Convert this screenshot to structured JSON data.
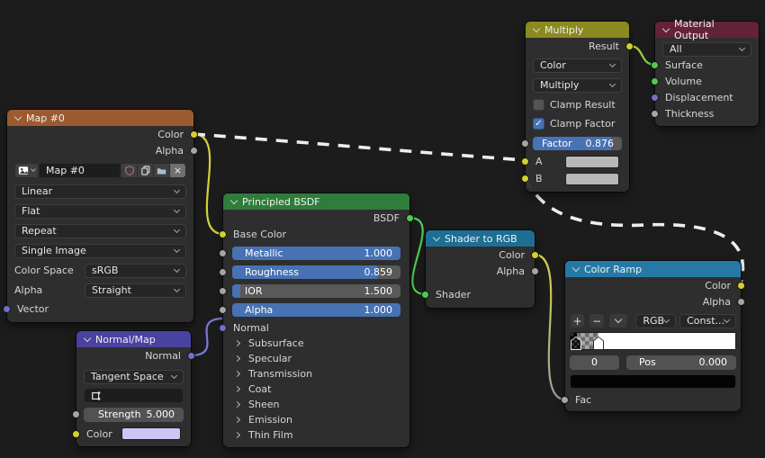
{
  "colors": {
    "background": "#1c1c1c",
    "accent_blue": "#4772b3",
    "header_texture": "#9d5a2e",
    "header_vector": "#4a42a0",
    "header_shader": "#2e7d3a",
    "header_converter_teal": "#1e6e94",
    "header_math_olive": "#8a8a20",
    "header_output_maroon": "#632238",
    "header_colorramp_blue": "#2679a6",
    "socket_color": "#d4cf2c",
    "socket_value": "#a5a5a5",
    "socket_shader": "#4ecb4e",
    "socket_vector": "#7070cf"
  },
  "nodes": {
    "map": {
      "title": "Map #0",
      "outputs": [
        {
          "label": "Color"
        },
        {
          "label": "Alpha"
        }
      ],
      "image_name": "Map #0",
      "dropdowns": [
        "Linear",
        "Flat",
        "Repeat",
        "Single Image"
      ],
      "color_space_label": "Color Space",
      "color_space_value": "sRGB",
      "alpha_label": "Alpha",
      "alpha_value": "Straight",
      "vector_label": "Vector"
    },
    "normal_map": {
      "title": "Normal/Map",
      "output_label": "Normal",
      "space_value": "Tangent Space",
      "strength_label": "Strength",
      "strength_value": "5.000",
      "color_label": "Color",
      "color_swatch": "#cbc6f4"
    },
    "principled": {
      "title": "Principled BSDF",
      "output_label": "BSDF",
      "base_color_label": "Base Color",
      "sliders": [
        {
          "label": "Metallic",
          "value": "1.000"
        },
        {
          "label": "Roughness",
          "value": "0.859"
        },
        {
          "label": "IOR",
          "value": "1.500"
        },
        {
          "label": "Alpha",
          "value": "1.000"
        }
      ],
      "normal_label": "Normal",
      "sections": [
        "Subsurface",
        "Specular",
        "Transmission",
        "Coat",
        "Sheen",
        "Emission",
        "Thin Film"
      ]
    },
    "shader_to_rgb": {
      "title": "Shader to RGB",
      "outputs": [
        {
          "label": "Color"
        },
        {
          "label": "Alpha"
        }
      ],
      "input_label": "Shader"
    },
    "multiply": {
      "title": "Multiply",
      "result_label": "Result",
      "type_value": "Color",
      "operation_value": "Multiply",
      "clamp_result_label": "Clamp Result",
      "clamp_factor_label": "Clamp Factor",
      "check_glyph": "✓",
      "factor_label": "Factor",
      "factor_value": "0.876",
      "a_label": "A",
      "b_label": "B",
      "ab_swatch": "#b8b8b8"
    },
    "material_output": {
      "title": "Material Output",
      "target_value": "All",
      "inputs": [
        "Surface",
        "Volume",
        "Displacement",
        "Thickness"
      ]
    },
    "color_ramp": {
      "title": "Color Ramp",
      "outputs": [
        {
          "label": "Color"
        },
        {
          "label": "Alpha"
        }
      ],
      "add_label": "+",
      "remove_label": "−",
      "color_mode": "RGB",
      "interpolation": "Const...",
      "index_value": "0",
      "pos_label": "Pos",
      "pos_value": "0.000",
      "stop_color": "#000000",
      "fac_label": "Fac"
    }
  }
}
